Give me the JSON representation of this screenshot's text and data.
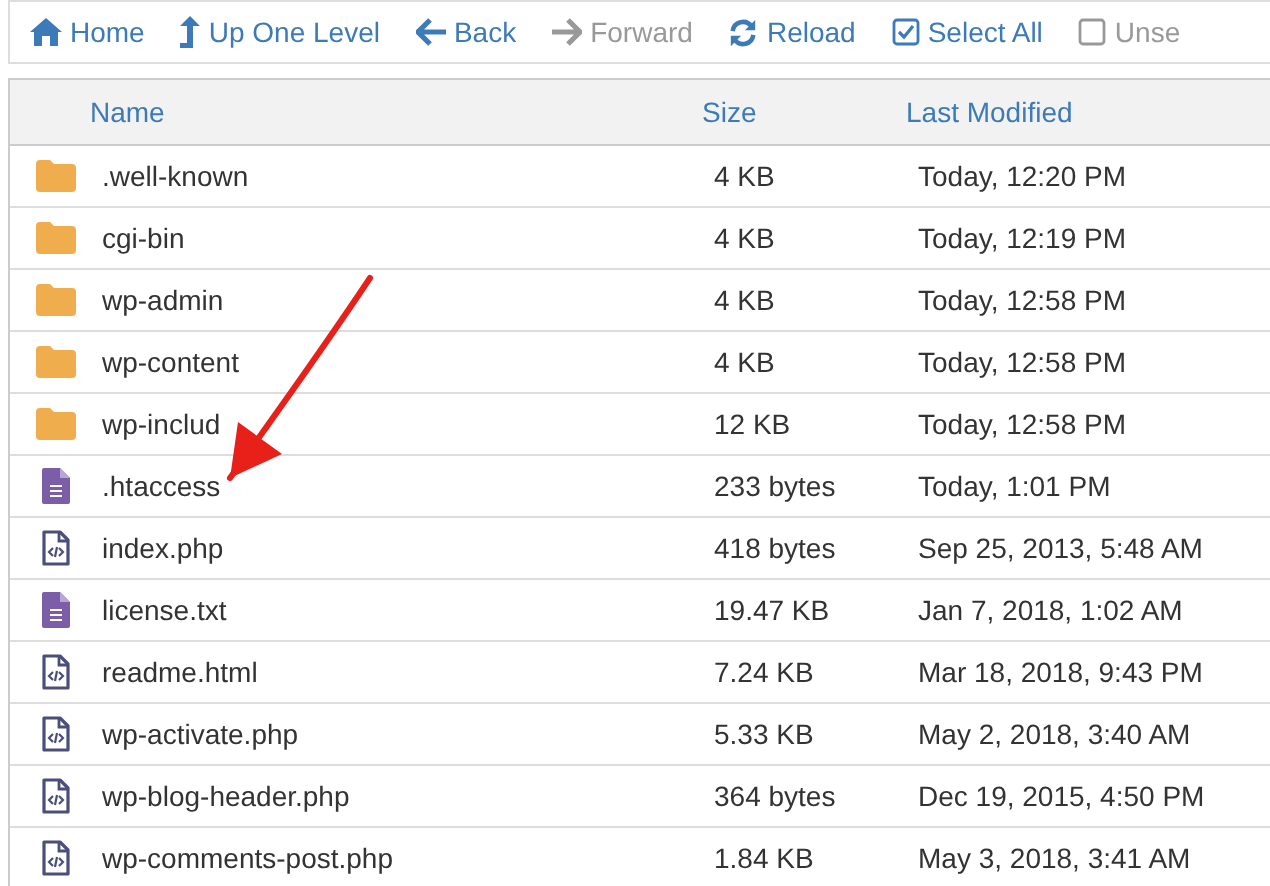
{
  "toolbar": [
    {
      "label": "Home",
      "kind": "home",
      "disabled": false
    },
    {
      "label": "Up One Level",
      "kind": "up",
      "disabled": false
    },
    {
      "label": "Back",
      "kind": "back",
      "disabled": false
    },
    {
      "label": "Forward",
      "kind": "forward",
      "disabled": true
    },
    {
      "label": "Reload",
      "kind": "reload",
      "disabled": false
    },
    {
      "label": "Select All",
      "kind": "checkbox",
      "checked": true,
      "disabled": false
    },
    {
      "label": "Unse",
      "kind": "checkbox",
      "checked": false,
      "disabled": true
    }
  ],
  "table": {
    "columns": [
      "Name",
      "Size",
      "Last Modified"
    ],
    "rows": [
      {
        "kind": "folder",
        "name": ".well-known",
        "size": "4 KB",
        "modified": "Today, 12:20 PM"
      },
      {
        "kind": "folder",
        "name": "cgi-bin",
        "size": "4 KB",
        "modified": "Today, 12:19 PM"
      },
      {
        "kind": "folder",
        "name": "wp-admin",
        "size": "4 KB",
        "modified": "Today, 12:58 PM"
      },
      {
        "kind": "folder",
        "name": "wp-content",
        "size": "4 KB",
        "modified": "Today, 12:58 PM"
      },
      {
        "kind": "folder",
        "name": "wp-includ",
        "size": "12 KB",
        "modified": "Today, 12:58 PM"
      },
      {
        "kind": "text",
        "name": ".htaccess",
        "size": "233 bytes",
        "modified": "Today, 1:01 PM"
      },
      {
        "kind": "code",
        "name": "index.php",
        "size": "418 bytes",
        "modified": "Sep 25, 2013, 5:48 AM"
      },
      {
        "kind": "text",
        "name": "license.txt",
        "size": "19.47 KB",
        "modified": "Jan 7, 2018, 1:02 AM"
      },
      {
        "kind": "code",
        "name": "readme.html",
        "size": "7.24 KB",
        "modified": "Mar 18, 2018, 9:43 PM"
      },
      {
        "kind": "code",
        "name": "wp-activate.php",
        "size": "5.33 KB",
        "modified": "May 2, 2018, 3:40 AM"
      },
      {
        "kind": "code",
        "name": "wp-blog-header.php",
        "size": "364 bytes",
        "modified": "Dec 19, 2015, 4:50 PM"
      },
      {
        "kind": "code",
        "name": "wp-comments-post.php",
        "size": "1.84 KB",
        "modified": "May 3, 2018, 3:41 AM"
      }
    ]
  },
  "annotation": {
    "kind": "arrow"
  }
}
